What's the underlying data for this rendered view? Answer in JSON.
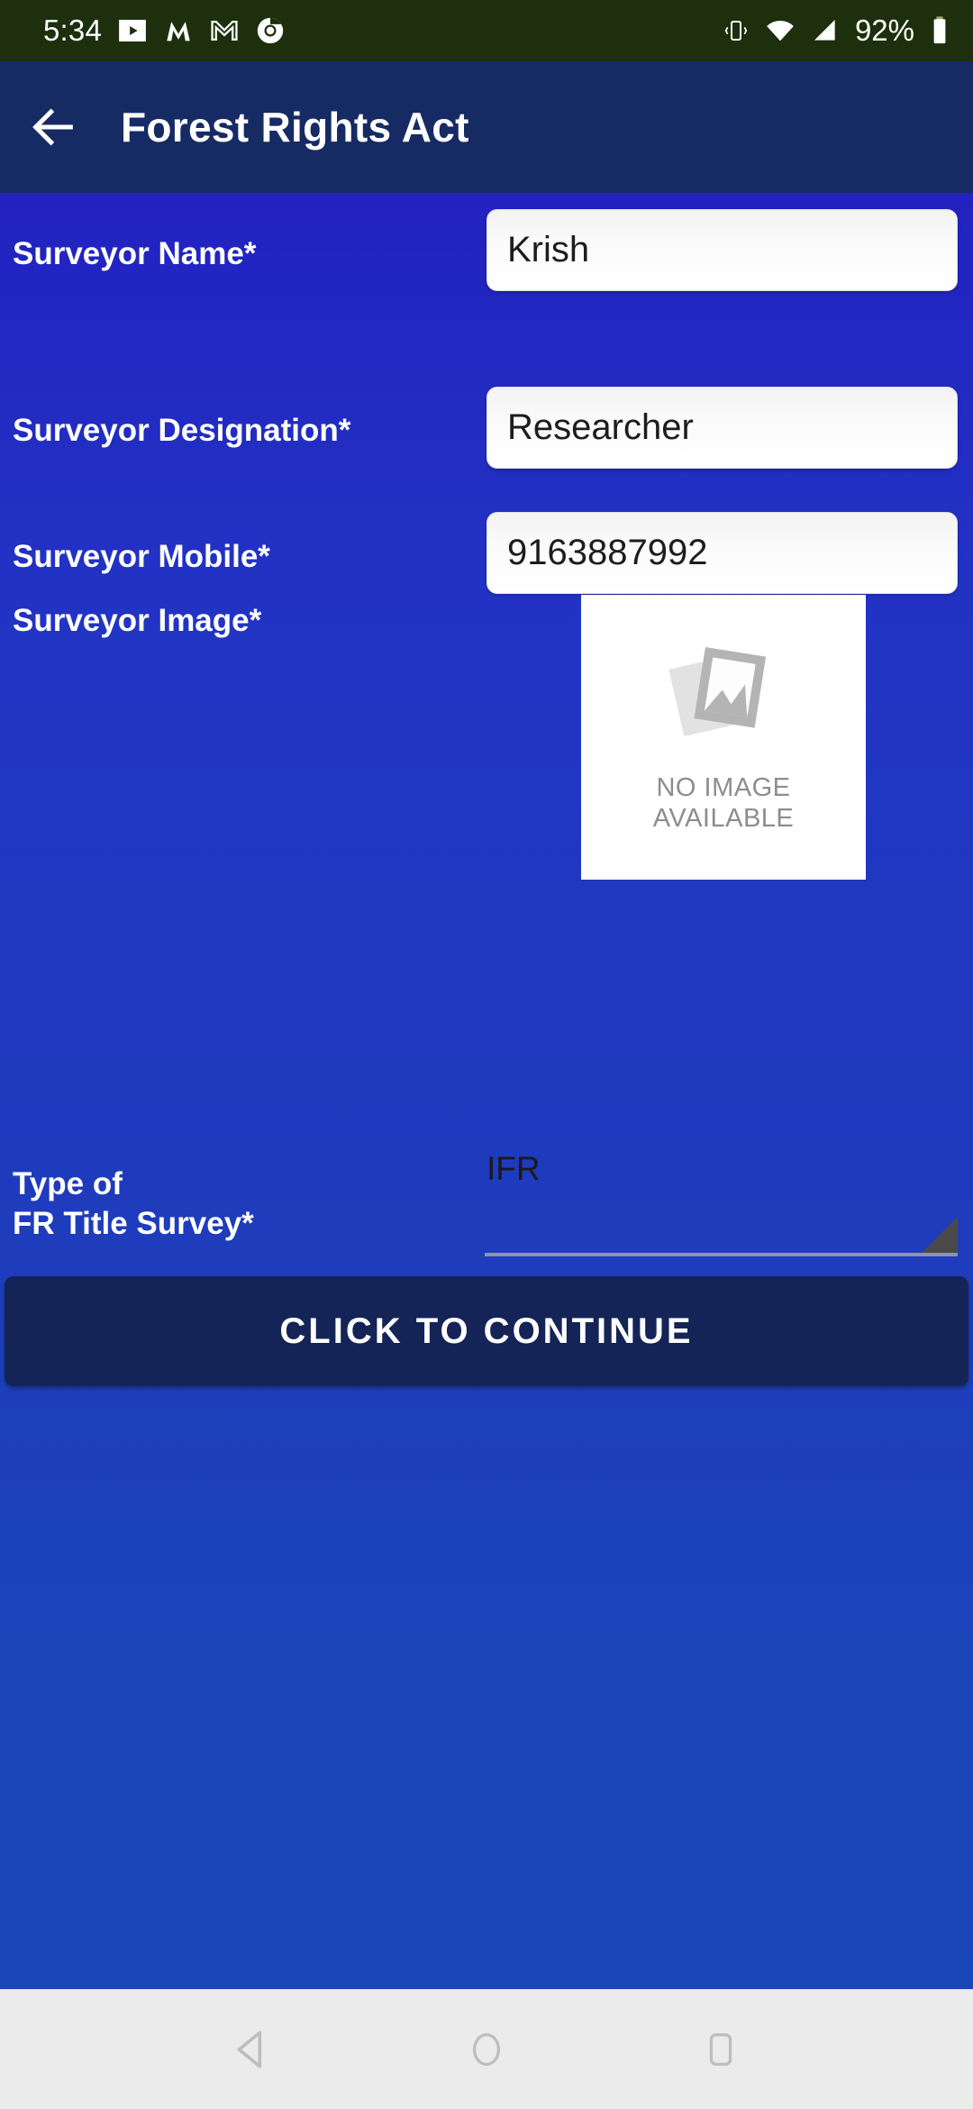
{
  "status_bar": {
    "time": "5:34",
    "battery_percent": "92%",
    "left_icons": [
      "youtube-music-icon",
      "m-app-icon",
      "gmail-icon",
      "chrome-icon"
    ],
    "right_icons": [
      "vibrate-icon",
      "wifi-icon",
      "cellular-signal-icon",
      "battery-icon"
    ],
    "background_color": "#1d2f0c"
  },
  "app_bar": {
    "title": "Forest Rights Act",
    "back_icon": "arrow-left-icon",
    "background_color": "#162a64"
  },
  "form": {
    "fields": [
      {
        "label": "Surveyor Name*",
        "value": "Krish",
        "type": "text"
      },
      {
        "label": "Surveyor Designation*",
        "value": "Researcher",
        "type": "text"
      },
      {
        "label": "Surveyor Mobile*",
        "value": "9163887992",
        "type": "tel"
      }
    ],
    "image_field": {
      "label": "Surveyor Image*",
      "placeholder_line1": "NO IMAGE",
      "placeholder_line2": "AVAILABLE",
      "icon": "image-placeholder-icon"
    },
    "spinner_field": {
      "label": "Type of\n FR Title Survey*",
      "selected": "IFR",
      "dropdown_icon": "dropdown-triangle-icon"
    }
  },
  "actions": {
    "continue_label": "CLICK TO CONTINUE"
  },
  "nav_bar": {
    "back": "nav-back-icon",
    "home": "nav-home-icon",
    "recents": "nav-recents-icon",
    "background_color": "#ebebeb"
  },
  "theme": {
    "background_top": "#2222c0",
    "background_bottom": "#1a47b7",
    "accent_dark": "#142457",
    "input_bg": "#fbfbfb"
  }
}
